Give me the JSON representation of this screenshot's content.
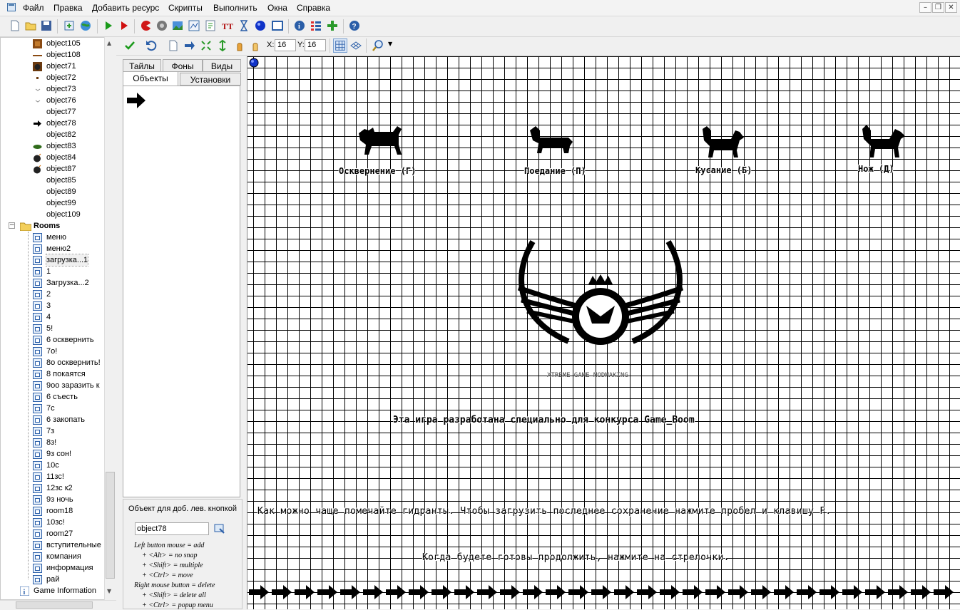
{
  "menu": {
    "items": [
      "Файл",
      "Правка",
      "Добавить ресурс",
      "Скрипты",
      "Выполнить",
      "Окна",
      "Справка"
    ]
  },
  "window_controls": {
    "minimize": "–",
    "restore": "❐",
    "close": "✕"
  },
  "toolbar": {
    "icons": [
      "new-icon",
      "open-icon",
      "save-icon",
      "export-icon",
      "publish-icon",
      "run-icon",
      "debug-icon",
      "add-sprite-icon",
      "add-sound-icon",
      "add-background-icon",
      "add-path-icon",
      "add-script-icon",
      "add-font-icon",
      "add-timeline-icon",
      "add-object-icon",
      "add-room-icon",
      "game-info-icon",
      "global-settings-icon",
      "extensions-icon",
      "help-icon"
    ]
  },
  "tree": {
    "objects": [
      {
        "label": "object105",
        "icon": "brown-square"
      },
      {
        "label": "object108",
        "icon": "line"
      },
      {
        "label": "object71",
        "icon": "face"
      },
      {
        "label": "object72",
        "icon": "dot"
      },
      {
        "label": "object73",
        "icon": "small"
      },
      {
        "label": "object76",
        "icon": "small"
      },
      {
        "label": "object77",
        "icon": "none"
      },
      {
        "label": "object78",
        "icon": "arrow"
      },
      {
        "label": "object82",
        "icon": "none"
      },
      {
        "label": "object83",
        "icon": "green"
      },
      {
        "label": "object84",
        "icon": "bomb"
      },
      {
        "label": "object87",
        "icon": "bomb"
      },
      {
        "label": "object85",
        "icon": "none"
      },
      {
        "label": "object89",
        "icon": "none"
      },
      {
        "label": "object99",
        "icon": "none"
      },
      {
        "label": "object109",
        "icon": "none"
      }
    ],
    "rooms_folder": "Rooms",
    "rooms": [
      "меню",
      "меню2",
      "загрузка...1",
      "1",
      "Загрузка...2",
      "2",
      "3",
      "4",
      "5!",
      "6 осквернить",
      "7o!",
      "8o осквернить!",
      "8 покаятся",
      "9oo заразить к",
      "6 съесть",
      "7c",
      "6 закопать",
      "7з",
      "8з!",
      "9з сон!",
      "10c",
      "11зс!",
      "12зс к2",
      "9з ночь",
      "room18",
      "10зс!",
      "room27",
      "вступительные",
      "компания",
      "информация",
      "рай"
    ],
    "game_info": "Game Information"
  },
  "room_toolbar": {
    "x_label": "X:",
    "x_value": "16",
    "y_label": "Y:",
    "y_value": "16"
  },
  "panel": {
    "tabs_top": [
      "Тайлы",
      "Фоны",
      "Виды"
    ],
    "tabs_bottom": [
      "Объекты",
      "Установки"
    ],
    "object_hint": "Объект для доб. лев. кнопкой",
    "selected_object": "object78",
    "help_lines": [
      "Left button mouse = add",
      "+ <Alt> = no snap",
      "+ <Shift> = multiple",
      "+ <Ctrl> = move",
      "Right mouse button = delete",
      "+ <Shift> = delete all",
      "+ <Ctrl> = popup menu"
    ]
  },
  "room": {
    "dog_labels": [
      "Осквернение (Г)",
      "Поедание (П)",
      "Кусание (Б)",
      "Нож (Д)"
    ],
    "logo_caption": "XTREME GAME MODMAKING",
    "line1": "Эта игра разработана специально для конкурса Game_Boom",
    "line2": "Как можно чаще помечайте гидранты. Чтобы загрузить последнее сохранение нажмите пробел и клавишу F.",
    "line3": "Когда будете готовы продолжить, нажмите на стрелочки.",
    "arrow_count": 31
  },
  "colors": {
    "grid": "#000000",
    "canvas": "#ffffff",
    "accent_blue": "#2a5ea8",
    "run_green": "#1a9a1a",
    "debug_red": "#d01010"
  }
}
